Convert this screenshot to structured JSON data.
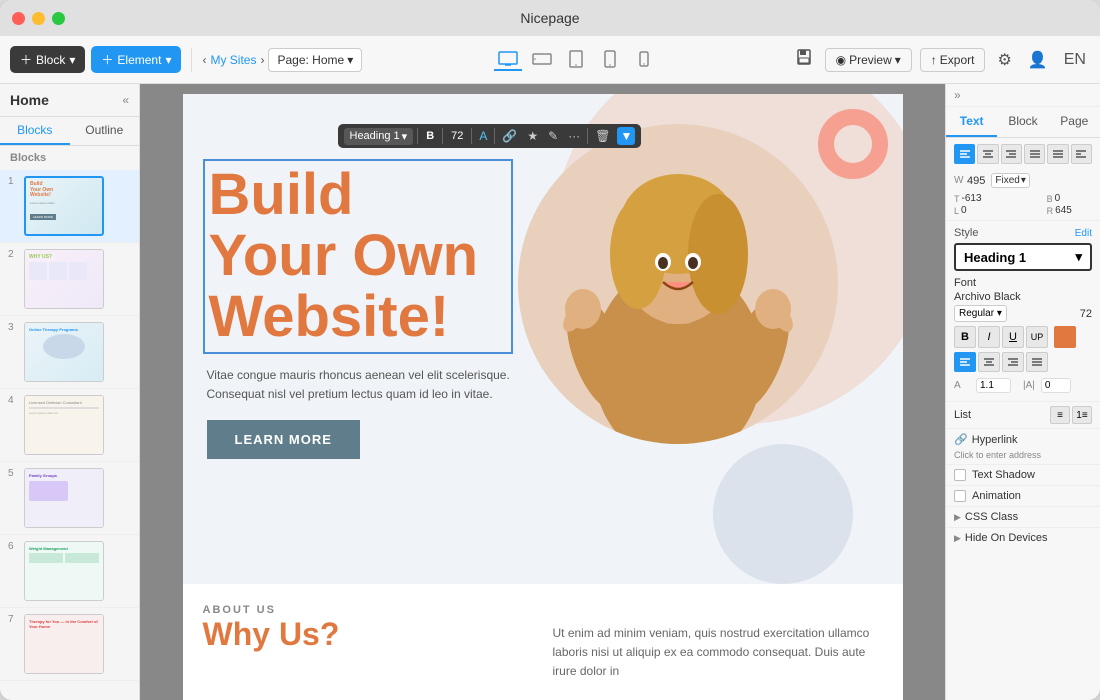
{
  "window": {
    "title": "Nicepage"
  },
  "toolbar": {
    "block_label": "Block",
    "element_label": "Element",
    "my_sites": "My Sites",
    "page_label": "Page: Home",
    "preview_label": "Preview",
    "export_label": "Export",
    "en_label": "EN"
  },
  "sidebar": {
    "title": "Home",
    "tab_blocks": "Blocks",
    "tab_outline": "Outline",
    "section_label": "Blocks",
    "pages": [
      {
        "num": "1",
        "thumb": "thumb1",
        "active": true
      },
      {
        "num": "2",
        "thumb": "thumb2",
        "active": false
      },
      {
        "num": "3",
        "thumb": "thumb3",
        "active": false
      },
      {
        "num": "4",
        "thumb": "thumb4",
        "active": false
      },
      {
        "num": "5",
        "thumb": "thumb5",
        "active": false
      },
      {
        "num": "6",
        "thumb": "thumb6",
        "active": false
      },
      {
        "num": "7",
        "thumb": "thumb7",
        "active": false
      }
    ]
  },
  "text_toolbar": {
    "heading": "Heading 1",
    "bold_label": "B",
    "size_label": "72",
    "color_label": "A"
  },
  "hero": {
    "heading_line1": "Build",
    "heading_line2": "Your Own",
    "heading_line3": "Website!",
    "subtext": "Vitae congue mauris rhoncus aenean vel elit scelerisque. Consequat nisl vel pretium lectus quam id leo in vitae.",
    "btn_label": "LEARN MORE"
  },
  "about": {
    "label": "ABOUT US",
    "heading": "Why Us?",
    "text": "Ut enim ad minim veniam, quis nostrud exercitation ullamco laboris nisi ut aliquip ex ea commodo consequat. Duis aute irure dolor in"
  },
  "right_panel": {
    "tabs": [
      "Text",
      "Block",
      "Page"
    ],
    "active_tab": "Text",
    "width": "495",
    "width_mode": "Fixed",
    "t": "-613",
    "b": "0",
    "l": "0",
    "r": "645",
    "style_label": "Style",
    "edit_label": "Edit",
    "heading_style": "Heading 1",
    "font_label": "Font",
    "font_name": "Archivo Black",
    "font_style": "Regular",
    "font_size": "72",
    "list_label": "List",
    "hyperlink_label": "Hyperlink",
    "hyperlink_placeholder": "Click to enter address",
    "text_shadow_label": "Text Shadow",
    "animation_label": "Animation",
    "css_class_label": "CSS Class",
    "hide_on_devices_label": "Hide On Devices",
    "spacing_a": "1.1",
    "spacing_b": "0",
    "bold": "B",
    "italic": "I",
    "underline": "U",
    "uppercase": "UP",
    "align_left": "≡",
    "align_center": "≡",
    "align_right": "≡",
    "align_justify": "≡"
  }
}
